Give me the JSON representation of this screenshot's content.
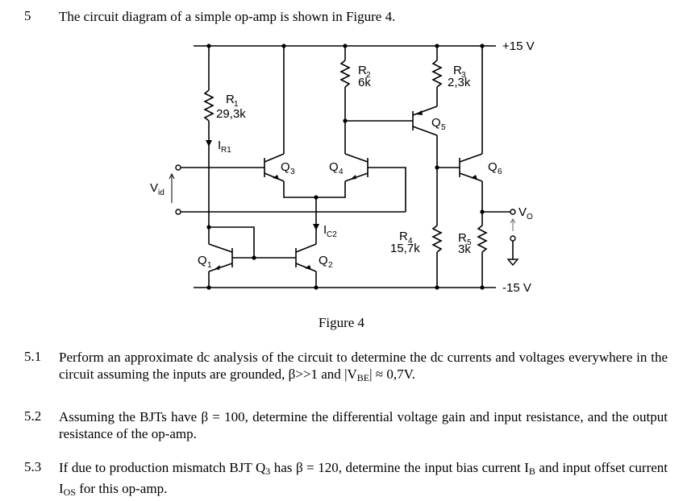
{
  "question": {
    "number": "5",
    "intro": "The circuit diagram of a simple op-amp is shown in Figure 4."
  },
  "figure": {
    "caption": "Figure 4",
    "supply_pos": "+15 V",
    "supply_neg": "-15 V",
    "input_label": "V",
    "input_sub": "id",
    "output_label": "V",
    "output_sub": "O",
    "components": {
      "R1": {
        "name": "R",
        "sub": "1",
        "value": "29,3k"
      },
      "R2": {
        "name": "R",
        "sub": "2",
        "value": "6k"
      },
      "R3": {
        "name": "R",
        "sub": "3",
        "value": "2,3k"
      },
      "R4": {
        "name": "R",
        "sub": "4",
        "value": "15,7k"
      },
      "R5": {
        "name": "R",
        "sub": "5",
        "value": "3k"
      },
      "Q1": {
        "name": "Q",
        "sub": "1"
      },
      "Q2": {
        "name": "Q",
        "sub": "2"
      },
      "Q3": {
        "name": "Q",
        "sub": "3"
      },
      "Q4": {
        "name": "Q",
        "sub": "4"
      },
      "Q5": {
        "name": "Q",
        "sub": "5"
      },
      "Q6": {
        "name": "Q",
        "sub": "6"
      }
    },
    "currents": {
      "IR1": {
        "name": "I",
        "sub": "R1"
      },
      "IC2": {
        "name": "I",
        "sub": "C2"
      }
    }
  },
  "subquestions": [
    {
      "number": "5.1",
      "text_before": "Perform an approximate dc analysis of the circuit to determine the dc currents and voltages everywhere in the circuit assuming the inputs are grounded, β>>1 and ",
      "math": "|V",
      "math_sub": "BE",
      "text_after": "| ≈ 0,7V."
    },
    {
      "number": "5.2",
      "text": "Assuming the BJTs have β = 100, determine the differential voltage gain and input resistance, and the output resistance of the op-amp."
    },
    {
      "number": "5.3",
      "text_a": "If due to production mismatch BJT Q",
      "sub_a": "3",
      "text_b": " has β = 120, determine the input bias current I",
      "sub_b": "B",
      "text_c": " and input offset current I",
      "sub_c": "OS",
      "text_d": " for this op-amp."
    }
  ]
}
